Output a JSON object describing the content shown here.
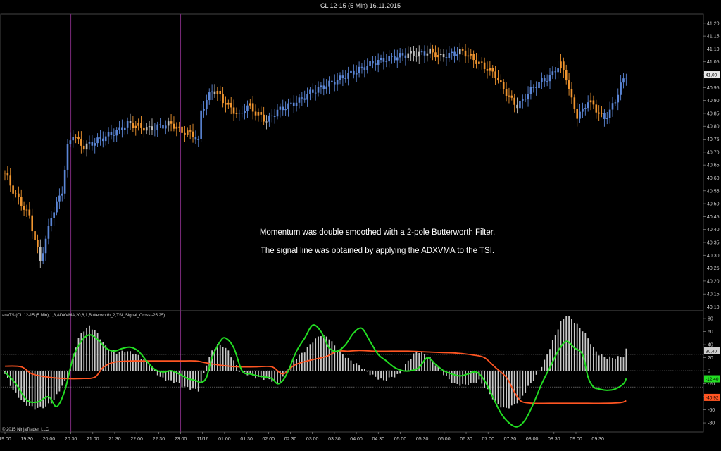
{
  "window": {
    "title": "CL 12-15 (5 Min)  16.11.2015"
  },
  "annotations": [
    "Momentum was double smoothed with a 2-pole Butterworth Filter.",
    "The signal line was obtained by applying the ADXVMA to the TSI."
  ],
  "indicator_label": "anaTSI(CL 12-15 (5 Min),1,8,ADXVMA,20,6,1,Butterworth_2,TSI_Signal_Cross,-25,25)",
  "copyright": "© 2015 NinjaTrader, LLC",
  "colors": {
    "up": "#5b86d6",
    "down": "#f0952f",
    "neutral": "#bdbdbd",
    "tsi": "#22dd22",
    "signal": "#ff5522",
    "histogram": "#c8c8c8",
    "session_line": "#7a2a7a"
  },
  "chart_data": [
    {
      "type": "candlestick",
      "title": "CL 12-15 (5 Min)  16.11.2015",
      "ylim": [
        40.085,
        41.235
      ],
      "y_ticks": [
        "41,20",
        "41,15",
        "41,10",
        "41,05",
        "41,00",
        "40,95",
        "40,90",
        "40,85",
        "40,80",
        "40,75",
        "40,70",
        "40,65",
        "40,60",
        "40,55",
        "40,50",
        "40,45",
        "40,40",
        "40,35",
        "40,30",
        "40,25",
        "40,20",
        "40,15",
        "40,10"
      ],
      "last_price_label": "41,00",
      "x_ticks": [
        "19:00",
        "19:30",
        "20:00",
        "20:30",
        "21:00",
        "21:30",
        "22:00",
        "22:30",
        "23:00",
        "11/16",
        "01:00",
        "01:30",
        "02:00",
        "02:30",
        "03:00",
        "03:30",
        "04:00",
        "04:30",
        "05:00",
        "05:30",
        "06:00",
        "06:30",
        "07:00",
        "07:30",
        "08:00",
        "08:30",
        "09:00",
        "09:30"
      ],
      "session_breaks": [
        "20:30",
        "23:00"
      ],
      "close_path": [
        [
          0,
          40.62
        ],
        [
          3,
          40.55
        ],
        [
          6,
          40.5
        ],
        [
          9,
          40.45
        ],
        [
          11,
          40.36
        ],
        [
          13,
          40.28
        ],
        [
          15,
          40.36
        ],
        [
          17,
          40.45
        ],
        [
          19,
          40.5
        ],
        [
          21,
          40.55
        ],
        [
          23,
          40.72
        ],
        [
          25,
          40.77
        ],
        [
          27,
          40.74
        ],
        [
          29,
          40.72
        ],
        [
          33,
          40.74
        ],
        [
          37,
          40.76
        ],
        [
          41,
          40.78
        ],
        [
          45,
          40.81
        ],
        [
          49,
          40.8
        ],
        [
          53,
          40.79
        ],
        [
          57,
          40.8
        ],
        [
          61,
          40.81
        ],
        [
          65,
          40.78
        ],
        [
          69,
          40.77
        ],
        [
          71,
          40.74
        ],
        [
          72,
          40.86
        ],
        [
          74,
          40.9
        ],
        [
          76,
          40.94
        ],
        [
          78,
          40.93
        ],
        [
          80,
          40.9
        ],
        [
          82,
          40.88
        ],
        [
          84,
          40.86
        ],
        [
          86,
          40.84
        ],
        [
          88,
          40.87
        ],
        [
          90,
          40.88
        ],
        [
          92,
          40.85
        ],
        [
          94,
          40.84
        ],
        [
          96,
          40.82
        ],
        [
          98,
          40.84
        ],
        [
          100,
          40.86
        ],
        [
          104,
          40.88
        ],
        [
          108,
          40.9
        ],
        [
          112,
          40.93
        ],
        [
          116,
          40.95
        ],
        [
          120,
          40.97
        ],
        [
          124,
          40.99
        ],
        [
          128,
          41.01
        ],
        [
          132,
          41.03
        ],
        [
          136,
          41.05
        ],
        [
          140,
          41.06
        ],
        [
          144,
          41.07
        ],
        [
          148,
          41.08
        ],
        [
          152,
          41.08
        ],
        [
          156,
          41.09
        ],
        [
          160,
          41.07
        ],
        [
          164,
          41.08
        ],
        [
          168,
          41.09
        ],
        [
          172,
          41.06
        ],
        [
          176,
          41.03
        ],
        [
          180,
          41.0
        ],
        [
          182,
          40.96
        ],
        [
          184,
          40.93
        ],
        [
          186,
          40.9
        ],
        [
          188,
          40.88
        ],
        [
          190,
          40.9
        ],
        [
          192,
          40.93
        ],
        [
          194,
          40.95
        ],
        [
          196,
          40.97
        ],
        [
          198,
          40.98
        ],
        [
          200,
          40.99
        ],
        [
          202,
          41.02
        ],
        [
          204,
          41.04
        ],
        [
          206,
          40.99
        ],
        [
          208,
          40.9
        ],
        [
          210,
          40.84
        ],
        [
          212,
          40.86
        ],
        [
          214,
          40.9
        ],
        [
          216,
          40.88
        ],
        [
          218,
          40.85
        ],
        [
          220,
          40.83
        ],
        [
          222,
          40.86
        ],
        [
          224,
          40.9
        ],
        [
          226,
          40.96
        ],
        [
          228,
          41.0
        ]
      ]
    },
    {
      "type": "line+histogram",
      "ylim": [
        -94,
        92
      ],
      "y_ticks": [
        "80",
        "60",
        "40",
        "20",
        "0",
        "-20",
        "-40",
        "-60",
        "-80"
      ],
      "levels": [
        25,
        0,
        -25
      ],
      "level_labels": {
        "upper": "30,40",
        "tsi": "-12,40",
        "signal": "-40,92"
      },
      "tsi_points": [
        [
          0,
          -2
        ],
        [
          4,
          -20
        ],
        [
          8,
          -45
        ],
        [
          12,
          -48
        ],
        [
          16,
          -40
        ],
        [
          19,
          -55
        ],
        [
          22,
          -30
        ],
        [
          25,
          20
        ],
        [
          28,
          45
        ],
        [
          31,
          55
        ],
        [
          34,
          48
        ],
        [
          37,
          35
        ],
        [
          40,
          30
        ],
        [
          43,
          34
        ],
        [
          46,
          36
        ],
        [
          49,
          30
        ],
        [
          52,
          15
        ],
        [
          55,
          2
        ],
        [
          58,
          -2
        ],
        [
          61,
          0
        ],
        [
          64,
          -5
        ],
        [
          67,
          -12
        ],
        [
          70,
          -15
        ],
        [
          72,
          -18
        ],
        [
          74,
          -10
        ],
        [
          76,
          20
        ],
        [
          79,
          45
        ],
        [
          81,
          50
        ],
        [
          84,
          35
        ],
        [
          87,
          0
        ],
        [
          90,
          -5
        ],
        [
          93,
          -8
        ],
        [
          96,
          -10
        ],
        [
          98,
          -12
        ],
        [
          100,
          -20
        ],
        [
          102,
          -15
        ],
        [
          104,
          0
        ],
        [
          107,
          30
        ],
        [
          110,
          50
        ],
        [
          113,
          70
        ],
        [
          116,
          60
        ],
        [
          119,
          35
        ],
        [
          122,
          30
        ],
        [
          125,
          40
        ],
        [
          128,
          58
        ],
        [
          131,
          65
        ],
        [
          134,
          45
        ],
        [
          137,
          25
        ],
        [
          140,
          15
        ],
        [
          143,
          5
        ],
        [
          146,
          0
        ],
        [
          149,
          0
        ],
        [
          152,
          5
        ],
        [
          155,
          20
        ],
        [
          158,
          10
        ],
        [
          161,
          0
        ],
        [
          164,
          -5
        ],
        [
          167,
          -8
        ],
        [
          170,
          -5
        ],
        [
          173,
          -2
        ],
        [
          176,
          -15
        ],
        [
          179,
          -40
        ],
        [
          182,
          -65
        ],
        [
          185,
          -80
        ],
        [
          188,
          -86
        ],
        [
          191,
          -75
        ],
        [
          194,
          -50
        ],
        [
          197,
          -20
        ],
        [
          200,
          5
        ],
        [
          203,
          30
        ],
        [
          206,
          45
        ],
        [
          209,
          35
        ],
        [
          212,
          25
        ],
        [
          214,
          -10
        ],
        [
          216,
          -25
        ],
        [
          218,
          -28
        ],
        [
          221,
          -30
        ],
        [
          224,
          -28
        ],
        [
          227,
          -20
        ],
        [
          228,
          -12
        ]
      ],
      "signal_points": [
        [
          0,
          7
        ],
        [
          6,
          6
        ],
        [
          10,
          -5
        ],
        [
          16,
          -10
        ],
        [
          22,
          -12
        ],
        [
          28,
          -12
        ],
        [
          33,
          -10
        ],
        [
          36,
          5
        ],
        [
          40,
          13
        ],
        [
          46,
          15
        ],
        [
          52,
          15
        ],
        [
          58,
          15
        ],
        [
          64,
          15
        ],
        [
          70,
          15
        ],
        [
          74,
          12
        ],
        [
          80,
          8
        ],
        [
          86,
          6
        ],
        [
          92,
          6
        ],
        [
          98,
          6
        ],
        [
          102,
          -5
        ],
        [
          106,
          8
        ],
        [
          110,
          14
        ],
        [
          114,
          18
        ],
        [
          118,
          22
        ],
        [
          122,
          30
        ],
        [
          126,
          30
        ],
        [
          130,
          31
        ],
        [
          136,
          30
        ],
        [
          142,
          30
        ],
        [
          148,
          30
        ],
        [
          154,
          29
        ],
        [
          160,
          28
        ],
        [
          166,
          27
        ],
        [
          172,
          24
        ],
        [
          176,
          20
        ],
        [
          180,
          5
        ],
        [
          184,
          -10
        ],
        [
          186,
          -25
        ],
        [
          188,
          -40
        ],
        [
          190,
          -48
        ],
        [
          194,
          -50
        ],
        [
          200,
          -50
        ],
        [
          208,
          -50
        ],
        [
          214,
          -50
        ],
        [
          220,
          -50
        ],
        [
          226,
          -49
        ],
        [
          228,
          -46
        ]
      ],
      "histogram_points": [
        [
          0,
          -5
        ],
        [
          3,
          -30
        ],
        [
          7,
          -50
        ],
        [
          11,
          -58
        ],
        [
          15,
          -55
        ],
        [
          18,
          -45
        ],
        [
          20,
          -30
        ],
        [
          23,
          -10
        ],
        [
          25,
          25
        ],
        [
          27,
          50
        ],
        [
          29,
          62
        ],
        [
          31,
          68
        ],
        [
          33,
          62
        ],
        [
          35,
          50
        ],
        [
          37,
          38
        ],
        [
          39,
          32
        ],
        [
          41,
          28
        ],
        [
          44,
          30
        ],
        [
          47,
          28
        ],
        [
          50,
          20
        ],
        [
          53,
          12
        ],
        [
          55,
          0
        ],
        [
          57,
          -10
        ],
        [
          60,
          -15
        ],
        [
          63,
          -18
        ],
        [
          66,
          -25
        ],
        [
          69,
          -28
        ],
        [
          71,
          -30
        ],
        [
          72,
          -20
        ],
        [
          74,
          10
        ],
        [
          76,
          30
        ],
        [
          78,
          40
        ],
        [
          80,
          38
        ],
        [
          82,
          30
        ],
        [
          84,
          15
        ],
        [
          86,
          0
        ],
        [
          89,
          -5
        ],
        [
          92,
          -10
        ],
        [
          95,
          -12
        ],
        [
          98,
          -15
        ],
        [
          100,
          -20
        ],
        [
          102,
          -10
        ],
        [
          104,
          5
        ],
        [
          107,
          20
        ],
        [
          110,
          30
        ],
        [
          113,
          45
        ],
        [
          116,
          55
        ],
        [
          119,
          50
        ],
        [
          121,
          38
        ],
        [
          124,
          25
        ],
        [
          127,
          15
        ],
        [
          130,
          8
        ],
        [
          133,
          -2
        ],
        [
          136,
          -10
        ],
        [
          139,
          -15
        ],
        [
          142,
          -10
        ],
        [
          145,
          -5
        ],
        [
          148,
          15
        ],
        [
          151,
          30
        ],
        [
          153,
          28
        ],
        [
          156,
          20
        ],
        [
          159,
          5
        ],
        [
          162,
          -10
        ],
        [
          165,
          -20
        ],
        [
          168,
          -22
        ],
        [
          171,
          -20
        ],
        [
          174,
          -15
        ],
        [
          177,
          -30
        ],
        [
          180,
          -48
        ],
        [
          183,
          -58
        ],
        [
          186,
          -55
        ],
        [
          189,
          -45
        ],
        [
          192,
          -25
        ],
        [
          195,
          -8
        ],
        [
          198,
          15
        ],
        [
          201,
          45
        ],
        [
          204,
          75
        ],
        [
          206,
          85
        ],
        [
          208,
          80
        ],
        [
          210,
          70
        ],
        [
          212,
          62
        ],
        [
          214,
          50
        ],
        [
          216,
          35
        ],
        [
          218,
          25
        ],
        [
          221,
          20
        ],
        [
          224,
          20
        ],
        [
          227,
          22
        ],
        [
          228,
          32
        ]
      ]
    }
  ]
}
